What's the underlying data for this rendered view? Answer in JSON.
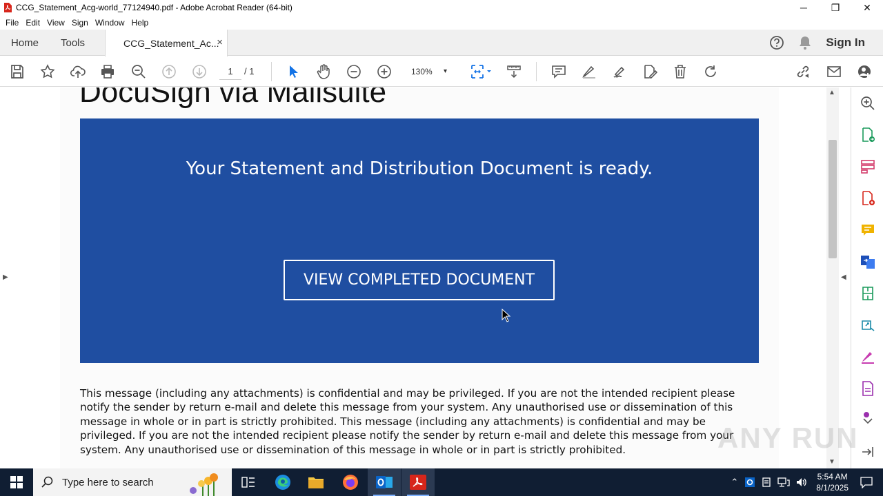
{
  "window": {
    "title": "CCG_Statement_Acg-world_77124940.pdf - Adobe Acrobat Reader (64-bit)",
    "minimize": "─",
    "maximize": "❐",
    "close": "✕"
  },
  "menu": [
    "File",
    "Edit",
    "View",
    "Sign",
    "Window",
    "Help"
  ],
  "tabs": {
    "home": "Home",
    "tools": "Tools",
    "document": "CCG_Statement_Ac...",
    "close": "×",
    "signin": "Sign In"
  },
  "toolbar": {
    "page_current": "1",
    "page_total": "/ 1",
    "zoom": "130%",
    "zoom_caret": "▾"
  },
  "document": {
    "heading": "DocuSign via Mailsuite",
    "banner_title": "Your Statement and Distribution Document is ready.",
    "button": "VIEW COMPLETED DOCUMENT",
    "disclaimer": "This message (including any attachments) is confidential and may be privileged. If you are not the intended recipient please notify the sender by return e-mail and delete this message from your system. Any unauthorised use or dissemination of this message in whole or in part is strictly prohibited. This message (including any attachments) is confidential and may be privileged. If you are not the intended recipient please notify the sender by return e-mail and delete this message from your system. Any unauthorised use or dissemination of this message in whole or in part is strictly prohibited.",
    "banner_color": "#1f4ea1"
  },
  "watermark": "ANY RUN",
  "taskbar": {
    "search_placeholder": "Type here to search",
    "time": "5:54 AM",
    "date": "8/1/2025"
  },
  "colors": {
    "acrobat_red": "#d7261b",
    "icon_gray": "#555555",
    "accent_blue": "#1473e6"
  }
}
